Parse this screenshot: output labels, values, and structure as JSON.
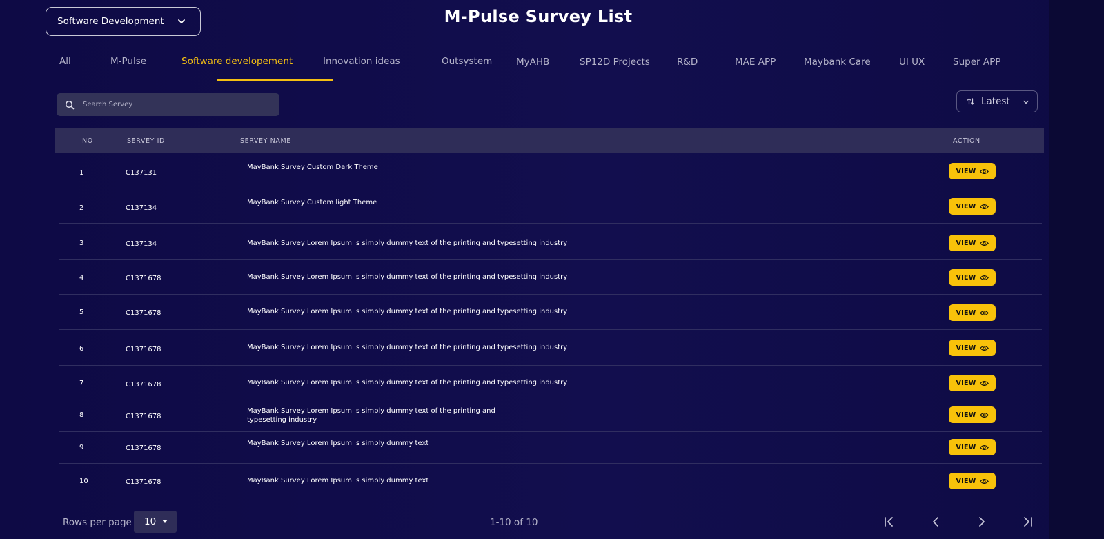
{
  "header": {
    "category_select": "Software Development",
    "title": "M-Pulse Survey List"
  },
  "tabs": [
    {
      "label": "All",
      "active": false
    },
    {
      "label": "M-Pulse",
      "active": false
    },
    {
      "label": "Software developement",
      "active": true
    },
    {
      "label": "Innovation ideas",
      "active": false
    },
    {
      "label": "Outsystem",
      "active": false
    },
    {
      "label": "MyAHB",
      "active": false
    },
    {
      "label": "SP12D Projects",
      "active": false
    },
    {
      "label": "R&D",
      "active": false
    },
    {
      "label": "MAE APP",
      "active": false
    },
    {
      "label": "Maybank Care",
      "active": false
    },
    {
      "label": "UI UX",
      "active": false
    },
    {
      "label": "Super APP",
      "active": false
    }
  ],
  "search": {
    "placeholder": "Search Servey",
    "icon": "search-icon"
  },
  "sort": {
    "label": "Latest",
    "icon": "sort-arrows-icon"
  },
  "table": {
    "columns": {
      "no": "NO",
      "id": "SERVEY ID",
      "name": "SERVEY NAME",
      "action": "ACTION"
    },
    "view_label": "VIEW",
    "rows": [
      {
        "no": "1",
        "id": "C137131",
        "name": "MayBank Survey Custom Dark Theme"
      },
      {
        "no": "2",
        "id": "C137134",
        "name": "MayBank Survey Custom light Theme"
      },
      {
        "no": "3",
        "id": "C137134",
        "name": "MayBank Survey Lorem Ipsum is simply dummy text of the printing and typesetting industry"
      },
      {
        "no": "4",
        "id": "C1371678",
        "name": "MayBank Survey Lorem Ipsum is simply dummy text of the printing and typesetting industry"
      },
      {
        "no": "5",
        "id": "C1371678",
        "name": "MayBank Survey Lorem Ipsum is simply dummy text of the printing and typesetting industry"
      },
      {
        "no": "6",
        "id": "C1371678",
        "name": "MayBank Survey Lorem Ipsum is simply dummy text of the printing and typesetting industry"
      },
      {
        "no": "7",
        "id": "C1371678",
        "name": "MayBank Survey Lorem Ipsum is simply dummy text of the printing and typesetting industry"
      },
      {
        "no": "8",
        "id": "C1371678",
        "name": "MayBank Survey Lorem Ipsum is simply dummy text of the printing and typesetting industry"
      },
      {
        "no": "9",
        "id": "C1371678",
        "name": "MayBank Survey Lorem Ipsum is simply dummy text"
      },
      {
        "no": "10",
        "id": "C1371678",
        "name": "MayBank Survey Lorem Ipsum is simply dummy text"
      }
    ]
  },
  "pagination": {
    "rows_per_page_label": "Rows per page",
    "rows_per_page_value": "10",
    "range_text": "1-10 of 10"
  },
  "colors": {
    "background": "#120e4e",
    "accent": "#f8c20a",
    "header_row": "#2f2d58"
  }
}
